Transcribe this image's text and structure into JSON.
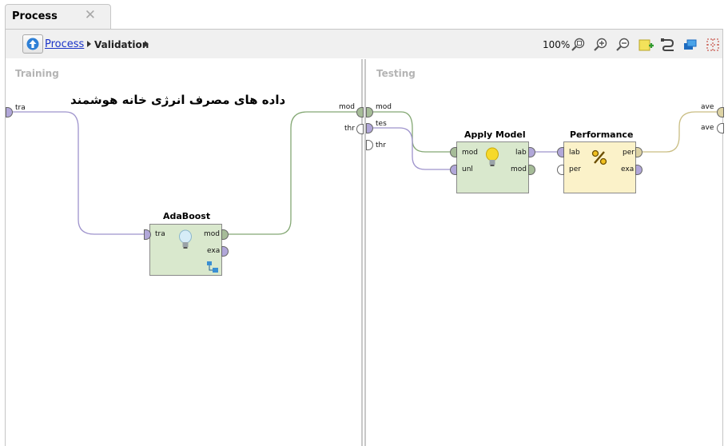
{
  "tab": {
    "title": "Process",
    "close": "✕"
  },
  "breadcrumb": {
    "parent": "Process",
    "current": "Validation"
  },
  "toolbar": {
    "zoom": "100%",
    "icons": [
      "zoom-fit-icon",
      "zoom-in-icon",
      "zoom-out-icon",
      "add-note-icon",
      "auto-wire-icon",
      "arrange-icon",
      "layout-grid-icon"
    ]
  },
  "panels": {
    "training": {
      "title": "Training",
      "inner_left_port": "tra",
      "inner_right_ports": [
        "mod",
        "thr"
      ]
    },
    "testing": {
      "title": "Testing",
      "inner_left_ports": [
        "mod",
        "tes",
        "thr"
      ],
      "inner_right_ports": [
        "ave",
        "ave"
      ]
    }
  },
  "annotation": "داده های مصرف انرژی خانه هوشمند",
  "operators": {
    "adaboost": {
      "title": "AdaBoost",
      "in": [
        "tra"
      ],
      "out": [
        "mod",
        "exa"
      ]
    },
    "apply_model": {
      "title": "Apply Model",
      "in": [
        "mod",
        "unl"
      ],
      "out": [
        "lab",
        "mod"
      ]
    },
    "performance": {
      "title": "Performance",
      "in": [
        "lab",
        "per"
      ],
      "out": [
        "per",
        "exa"
      ]
    }
  },
  "colors": {
    "wire_purple": "#9e93cc",
    "wire_green": "#84a874",
    "wire_tan": "#c9bd82",
    "link": "#1a33c8"
  }
}
